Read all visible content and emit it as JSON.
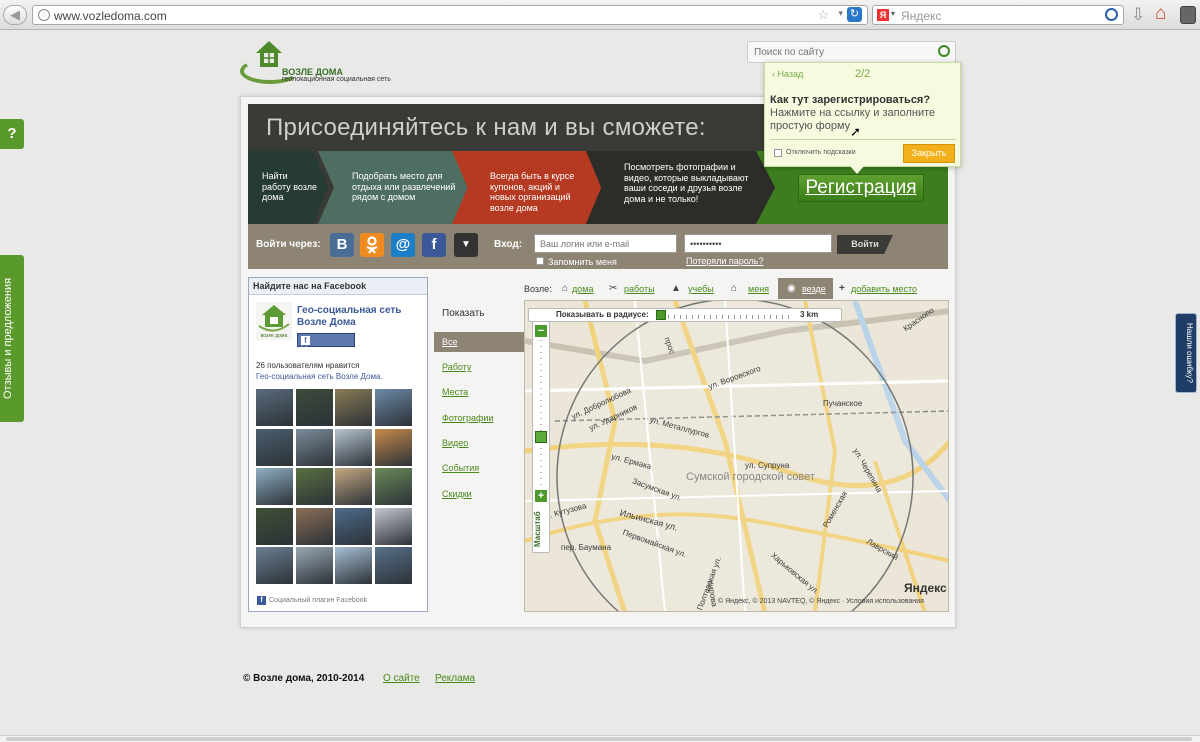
{
  "browser": {
    "url": "www.vozledoma.com",
    "search_engine": "Яндекс",
    "search_engine_logo": "Я"
  },
  "site": {
    "logo_title": "ВОЗЛЕ ДОМА",
    "logo_subtitle": "геолокационная социальная сеть",
    "search_placeholder": "Поиск по сайту"
  },
  "banner": {
    "heading": "Присоединяйтесь к нам и вы сможете:",
    "steps": [
      "Найти работу возле дома",
      "Подобрать место для отдыха или развлечений рядом с домом",
      "Всегда быть в курсе купонов, акций и новых организаций возле дома",
      "Посмотреть фотографии и видео, которые выкладывают ваши соседи и друзья возле дома и не только!"
    ],
    "register_label": "Регистрация"
  },
  "login": {
    "via_label": "Войти через:",
    "social": [
      "В",
      "ok-icon",
      "@",
      "f",
      "▼"
    ],
    "login_label": "Вход:",
    "login_placeholder": "Ваш логин или e-mail",
    "password_value": "••••••••••",
    "submit_label": "Войти",
    "remember_label": "Запомнить меня",
    "forgot_label": "Потеряли пароль?"
  },
  "facebook": {
    "header": "Найдите нас на Facebook",
    "page_name": "Гео-социальная сеть Возле Дома",
    "like_label": "Нравится",
    "likes_count": "26 пользователям нравится",
    "likes_page": "Гео-социальная сеть Возле Дома.",
    "footer": "Социальный плагин Facebook",
    "logo_caption": "возле дома"
  },
  "categories": {
    "show_label": "Показать",
    "items": [
      "Все",
      "Работу",
      "Места",
      "Фотографии",
      "Видео",
      "События",
      "Скидки"
    ]
  },
  "nearby": {
    "label": "Возле:",
    "items": [
      "дома",
      "работы",
      "учебы",
      "меня",
      "везде",
      "добавить место"
    ]
  },
  "map": {
    "radius_label": "Показывать в радиусе:",
    "radius_value": "3 km",
    "scale_label": "Масштаб",
    "district": "Сумской городской совет",
    "streets": [
      "ул. Добролюбова",
      "ул. Ударников",
      "ул. Металлургов",
      "ул. Воровского",
      "Пучанское",
      "Краснопо",
      "ул. Ермака",
      "ул. Супруна",
      "ул. Черепина",
      "Засумская ул.",
      "ул. Кутузова",
      "Ильинская ул.",
      "пер. Баумана",
      "Первомайская ул.",
      "Харьковская ул.",
      "Лаврский",
      "Кирова",
      "Полтавская ул.",
      "прос",
      "Роменская"
    ],
    "yandex": "Яндекс",
    "copyright": "© Яндекс, © 2013 NAVTEQ, © Яндекс · Условия использования"
  },
  "tooltip": {
    "back_label": "Назад",
    "page": "2/2",
    "title": "Как тут зарегистрироваться?",
    "body": "Нажмите на ссылку и заполните простую форму",
    "disable_label": "Отключить подсказки",
    "close_label": "Закрыть"
  },
  "side": {
    "help": "?",
    "feedback": "Отзывы и предложения",
    "error": "Нашли ошибку?"
  },
  "footer": {
    "copyright": "© Возле дома, 2010-2014",
    "about": "О сайте",
    "ads": "Реклама"
  },
  "colors": {
    "brand_green": "#4a8a1c",
    "banner_dark": "#3a3a36",
    "red_step": "#b53a21",
    "tooltip_button": "#f4b01a"
  }
}
